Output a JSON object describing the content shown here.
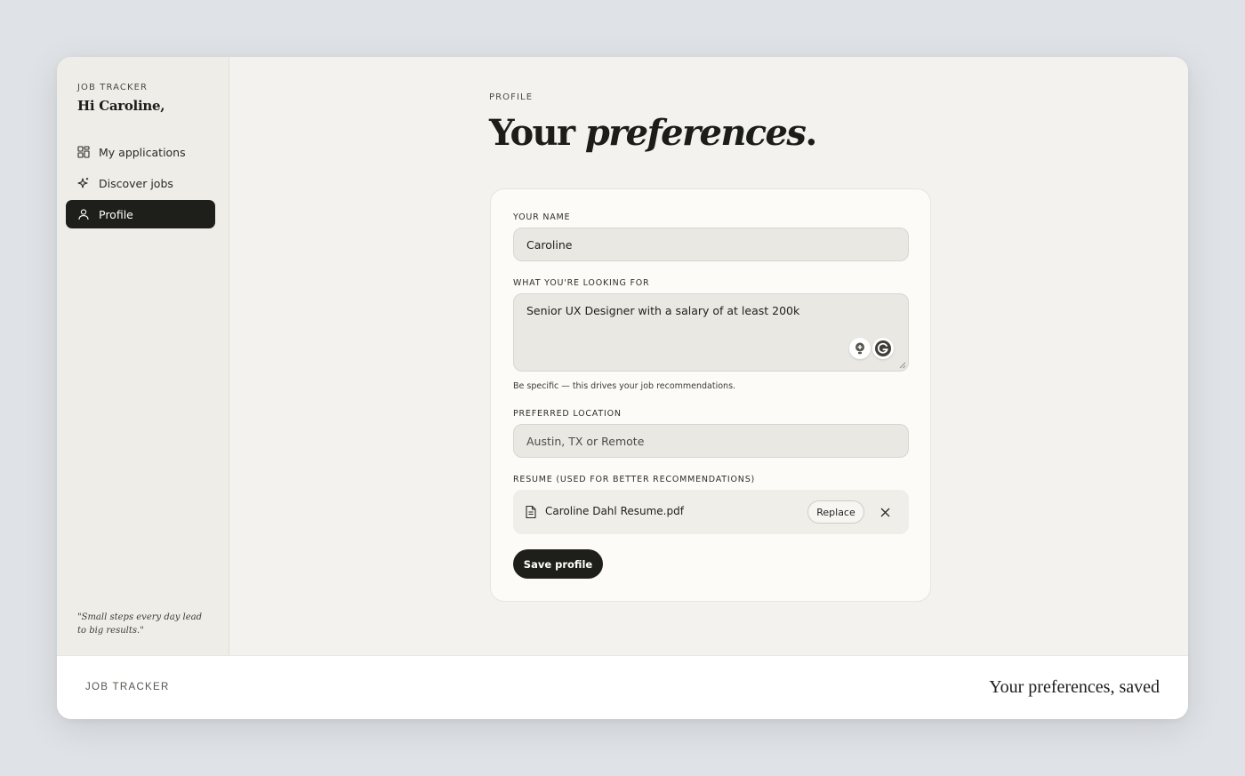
{
  "sidebar": {
    "brand": "JOB TRACKER",
    "greeting": "Hi Caroline,",
    "items": [
      {
        "label": "My applications",
        "icon": "grid-icon",
        "active": false
      },
      {
        "label": "Discover jobs",
        "icon": "sparkle-icon",
        "active": false
      },
      {
        "label": "Profile",
        "icon": "user-icon",
        "active": true
      }
    ],
    "quote": "\"Small steps every day lead to big results.\""
  },
  "main": {
    "eyebrow": "PROFILE",
    "title_plain": "Your ",
    "title_italic": "preferences",
    "title_end": ".",
    "form": {
      "name_label": "YOUR NAME",
      "name_value": "Caroline",
      "looking_label": "WHAT YOU'RE LOOKING FOR",
      "looking_value": "Senior UX Designer with a salary of at least 200k",
      "looking_hint": "Be specific — this drives your job recommendations.",
      "location_label": "PREFERRED LOCATION",
      "location_placeholder": "Austin, TX or Remote",
      "resume_label": "RESUME (USED FOR BETTER RECOMMENDATIONS)",
      "resume_file": "Caroline Dahl Resume.pdf",
      "replace_label": "Replace",
      "save_label": "Save profile"
    }
  },
  "footer": {
    "brand": "JOB TRACKER",
    "status": "Your preferences, saved"
  },
  "colors": {
    "accent_dark": "#1e1e1a",
    "page_bg": "#dfe2e6",
    "panel_bg": "#f3f2ee"
  }
}
